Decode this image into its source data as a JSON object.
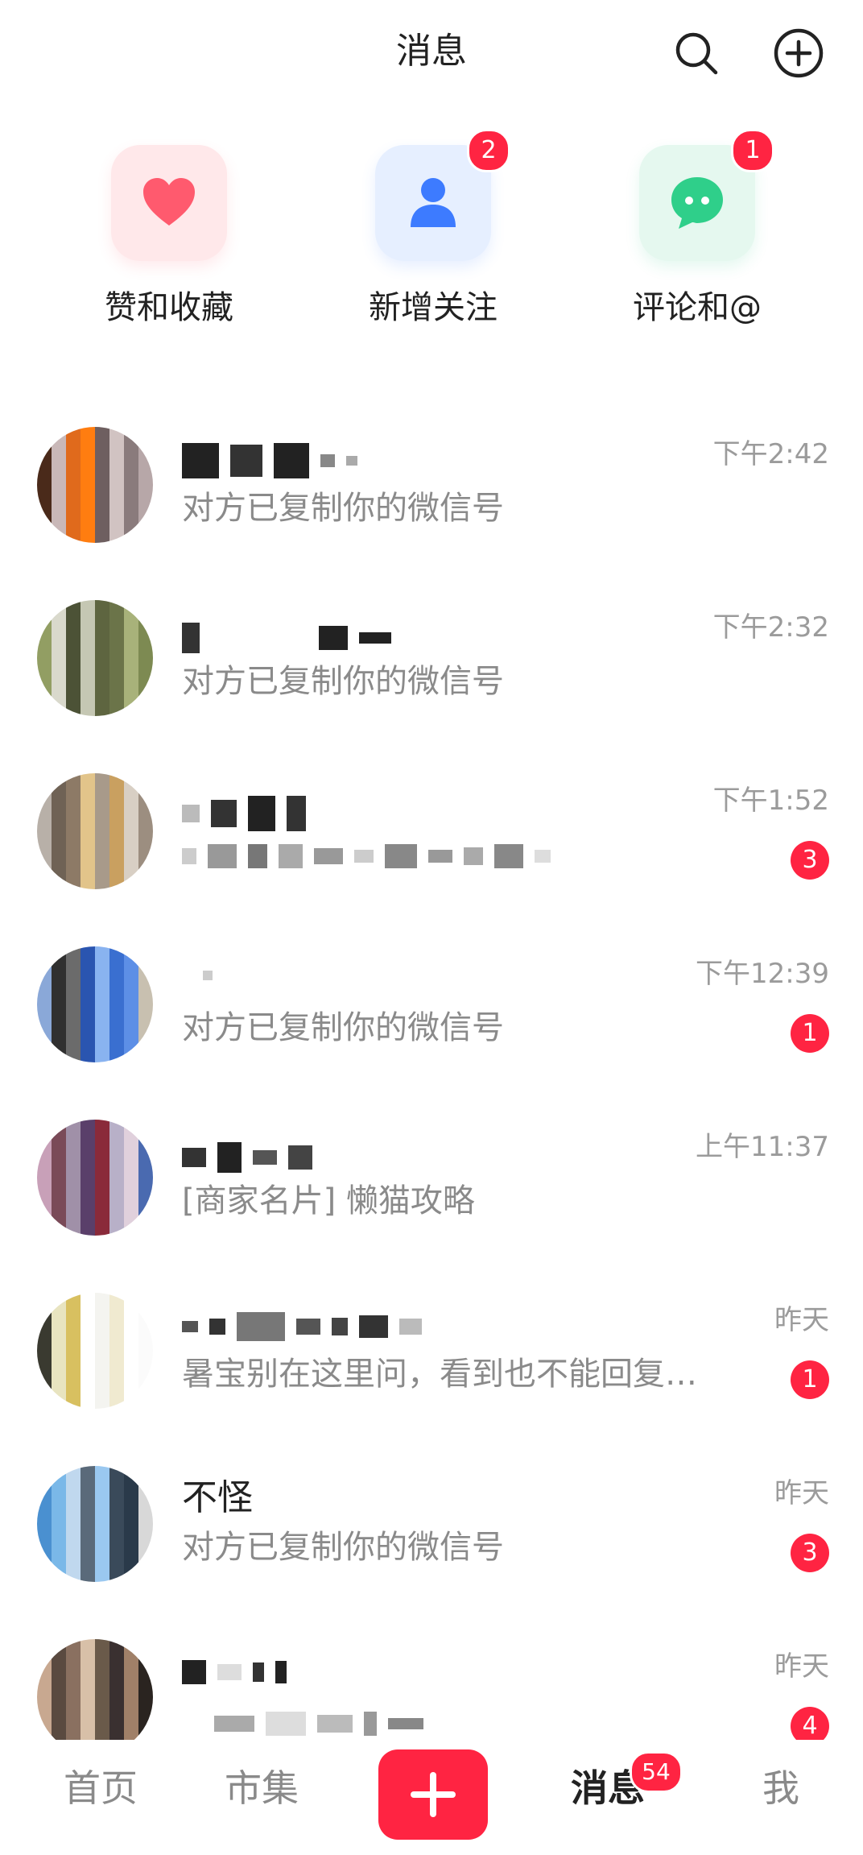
{
  "header": {
    "title": "消息"
  },
  "quick_actions": [
    {
      "label": "赞和收藏",
      "icon": "heart-icon",
      "badge": ""
    },
    {
      "label": "新增关注",
      "icon": "person-icon",
      "badge": "2"
    },
    {
      "label": "评论和@",
      "icon": "comment-icon",
      "badge": "1"
    }
  ],
  "messages": [
    {
      "name": "",
      "preview": "对方已复制你的微信号",
      "time": "下午2:42",
      "badge": ""
    },
    {
      "name": "",
      "preview": "对方已复制你的微信号",
      "time": "下午2:32",
      "badge": ""
    },
    {
      "name": "",
      "preview": "",
      "time": "下午1:52",
      "badge": "3"
    },
    {
      "name": "",
      "preview": "对方已复制你的微信号",
      "time": "下午12:39",
      "badge": "1"
    },
    {
      "name": "",
      "preview": "[商家名片] 懒猫攻略",
      "time": "上午11:37",
      "badge": ""
    },
    {
      "name": "",
      "preview": "暑宝别在这里问，看到也不能回复…",
      "time": "昨天",
      "badge": "1"
    },
    {
      "name": "不怪",
      "preview": "对方已复制你的微信号",
      "time": "昨天",
      "badge": "3"
    },
    {
      "name": "",
      "preview": "",
      "time": "昨天",
      "badge": "4"
    }
  ],
  "bottom_nav": {
    "home": "首页",
    "market": "市集",
    "messages": "消息",
    "messages_badge": "54",
    "me": "我",
    "active": "messages"
  },
  "colors": {
    "accent": "#ff2442",
    "heart": "#ff5a6e",
    "follow": "#3d7bff",
    "comment": "#2fcf8a"
  }
}
